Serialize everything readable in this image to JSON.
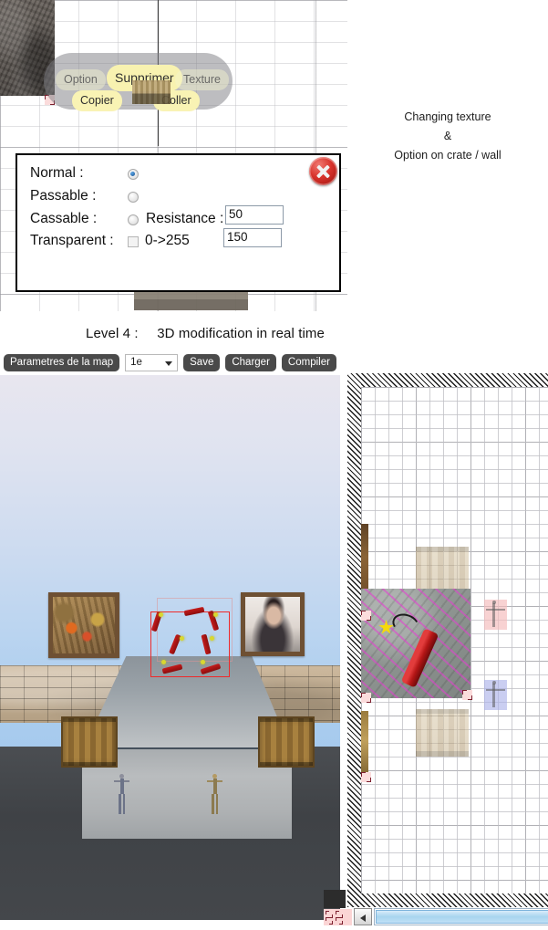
{
  "context_menu": {
    "name": "tile-context-menu",
    "items": [
      {
        "label": "Option",
        "state": "dim"
      },
      {
        "label": "Supprimer",
        "state": "highlighted"
      },
      {
        "label": "Texture",
        "state": "dim"
      },
      {
        "label": "Copier",
        "state": "normal"
      },
      {
        "label": "Coller",
        "state": "normal"
      }
    ]
  },
  "properties_dialog": {
    "title": "",
    "rows": {
      "normal_label": "Normal :",
      "passable_label": "Passable :",
      "cassable_label": "Cassable :",
      "transparent_label": "Transparent :",
      "resistance_label": "Resistance :",
      "range_label": "0->255"
    },
    "values": {
      "normal_selected": true,
      "passable_selected": false,
      "cassable_selected": false,
      "transparent_checked": false,
      "resistance": "50",
      "alpha": "150"
    },
    "close_icon": "close-circle-icon"
  },
  "annotation": {
    "line1": "Changing texture",
    "line2": "&",
    "line3": "Option on crate / wall"
  },
  "caption": {
    "level": "Level 4 :",
    "text": "3D modification in real time"
  },
  "toolbar": {
    "map_params_label": "Parametres de la map",
    "layer_value": "1e",
    "save_label": "Save",
    "load_label": "Charger",
    "compile_label": "Compiler"
  },
  "colors": {
    "accent_red": "#ef2a2a",
    "highlight_yellow": "#f8f2b0",
    "toolbar_button": "#4a4a4a",
    "radio_blue": "#14508f",
    "scrollbar_blue": "#a8d4ef",
    "marker_pink": "#fbd5d5"
  },
  "viewport": {
    "name": "3d-viewport",
    "objects": [
      "wall-painting-left",
      "wall-painting-right",
      "brick-wall",
      "concrete-platform",
      "crate-left",
      "crate-right",
      "dynamite-selection-box",
      "character-blue",
      "character-tan"
    ]
  },
  "map_panel": {
    "name": "2d-map-editor",
    "tiles": [
      {
        "type": "dynamite-texture-tile"
      },
      {
        "type": "crate-tile"
      },
      {
        "type": "crate-tile"
      },
      {
        "type": "wall-tile"
      },
      {
        "type": "wall-tile"
      },
      {
        "type": "character-tile-pink"
      },
      {
        "type": "character-tile-blue"
      }
    ]
  },
  "scrollbar": {
    "left_arrow_icon": "triangle-left-icon",
    "selection_marker_icon": "resize-marker-icon"
  }
}
